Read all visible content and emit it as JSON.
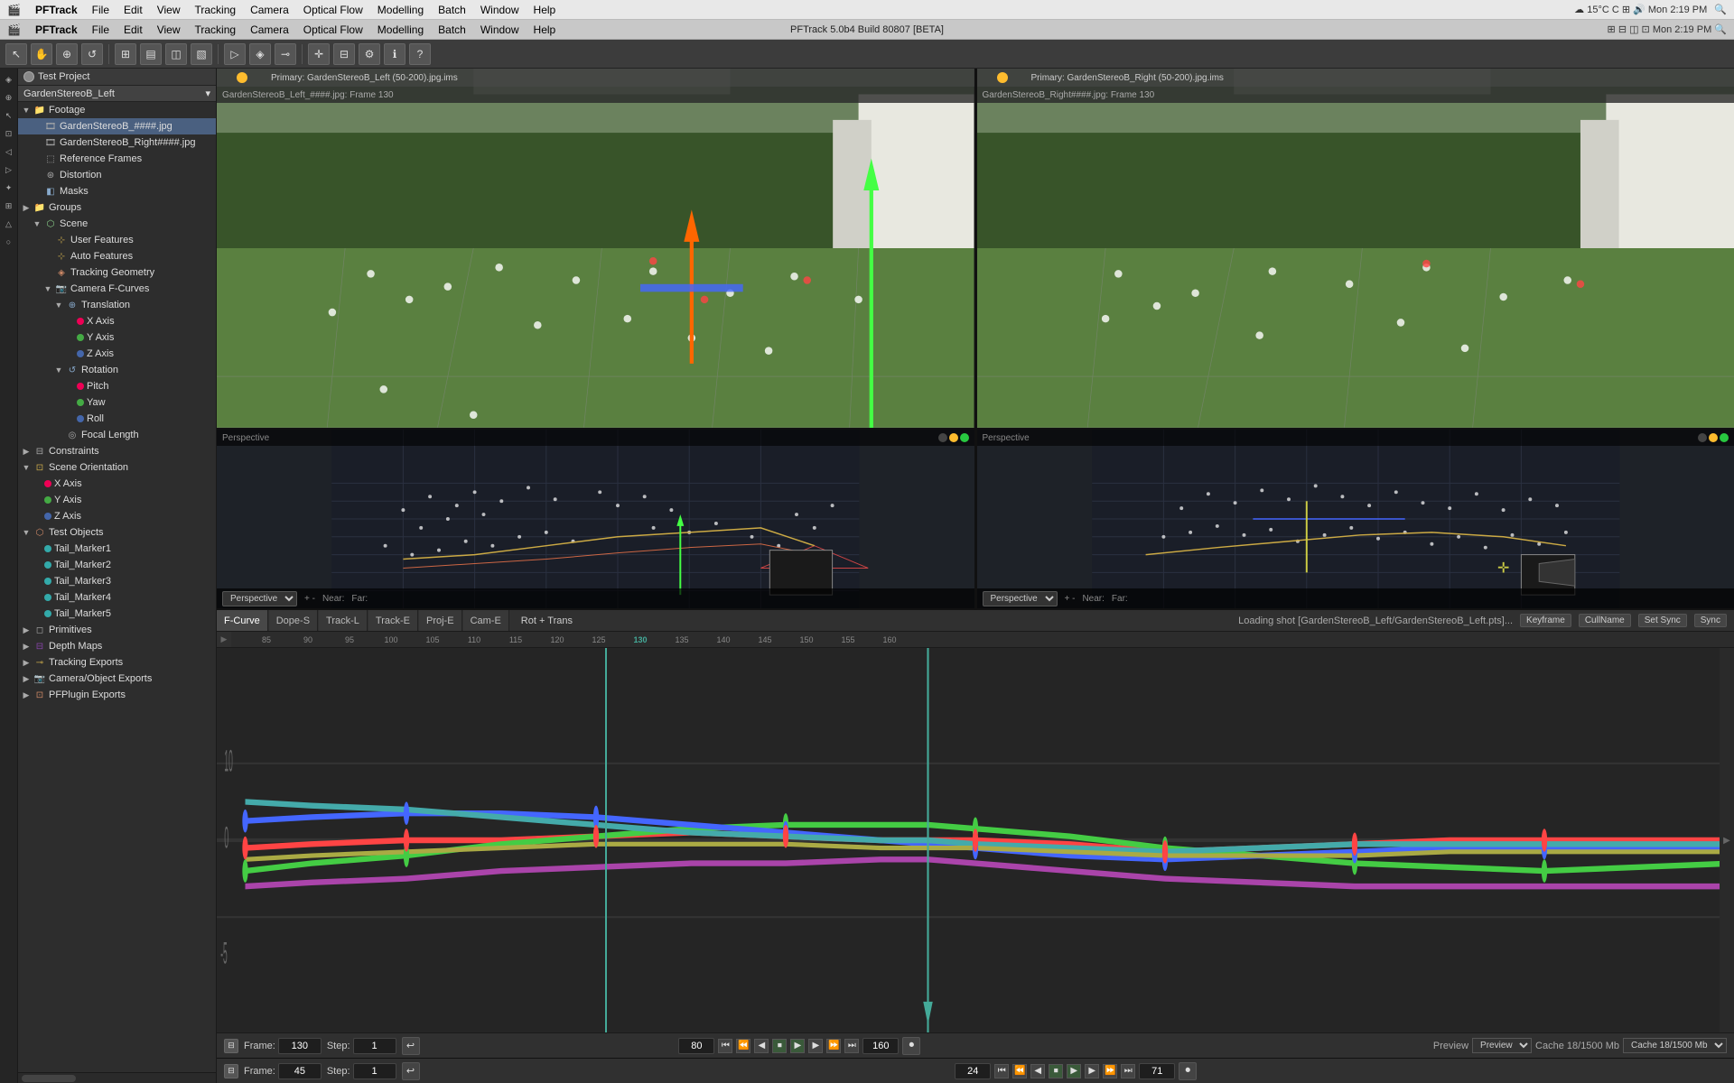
{
  "app": {
    "name": "PFTrack",
    "title": "PFTrack 5.0b4 Build 80807 [BETA]",
    "primary_label": "Primary: GardenStereoB_Left (50-200).jpg.ims",
    "primary_label2": "Primary: GardenStereoB_Right (50-200).jpg.ims"
  },
  "menu": {
    "items": [
      "PFTrack",
      "File",
      "Edit",
      "View",
      "Tracking",
      "Camera",
      "Optical Flow",
      "Modelling",
      "Batch",
      "Window",
      "Help"
    ]
  },
  "toolbar": {
    "buttons": [
      "⊞",
      "▭",
      "▤",
      "⊡",
      "◫",
      "▷",
      "◁",
      "↺",
      "⊕",
      "⊗",
      "⌖",
      "✛",
      "⊸",
      "≡",
      "⊟",
      "⊞",
      "□",
      "◈",
      "▣",
      "⊠"
    ]
  },
  "left_panel": {
    "project_name": "Test Project",
    "camera_name": "GardenStereoB_Left",
    "tree": [
      {
        "id": "footage",
        "label": "Footage",
        "level": 0,
        "icon": "folder",
        "expanded": true
      },
      {
        "id": "gardenL",
        "label": "GardenStereoB_####.jpg",
        "level": 1,
        "icon": "film",
        "selected": true
      },
      {
        "id": "gardenR",
        "label": "GardenStereoB_Right####.jpg",
        "level": 1,
        "icon": "film"
      },
      {
        "id": "refframes",
        "label": "Reference Frames",
        "level": 1,
        "icon": "img"
      },
      {
        "id": "distortion",
        "label": "Distortion",
        "level": 1,
        "icon": "distort"
      },
      {
        "id": "masks",
        "label": "Masks",
        "level": 1,
        "icon": "mask"
      },
      {
        "id": "groups",
        "label": "Groups",
        "level": 0,
        "icon": "folder"
      },
      {
        "id": "scene",
        "label": "Scene",
        "level": 1,
        "icon": "scene",
        "expanded": true
      },
      {
        "id": "userfeatures",
        "label": "User Features",
        "level": 2,
        "icon": "feat"
      },
      {
        "id": "autofeatures",
        "label": "Auto Features",
        "level": 2,
        "icon": "feat"
      },
      {
        "id": "trackgeom",
        "label": "Tracking Geometry",
        "level": 2,
        "icon": "geom"
      },
      {
        "id": "camfcurves",
        "label": "Camera F-Curves",
        "level": 2,
        "icon": "curve",
        "expanded": true
      },
      {
        "id": "translation",
        "label": "Translation",
        "level": 3,
        "icon": "trans",
        "expanded": true
      },
      {
        "id": "xaxis",
        "label": "X Axis",
        "level": 4,
        "icon": "axis",
        "color": "red"
      },
      {
        "id": "yaxis",
        "label": "Y Axis",
        "level": 4,
        "icon": "axis",
        "color": "green"
      },
      {
        "id": "zaxis",
        "label": "Z Axis",
        "level": 4,
        "icon": "axis",
        "color": "blue"
      },
      {
        "id": "rotation",
        "label": "Rotation",
        "level": 3,
        "icon": "rot",
        "expanded": true
      },
      {
        "id": "pitch",
        "label": "Pitch",
        "level": 4,
        "icon": "axis",
        "color": "red"
      },
      {
        "id": "yaw",
        "label": "Yaw",
        "level": 4,
        "icon": "axis",
        "color": "green"
      },
      {
        "id": "roll",
        "label": "Roll",
        "level": 4,
        "icon": "axis",
        "color": "blue"
      },
      {
        "id": "focallength",
        "label": "Focal Length",
        "level": 3,
        "icon": "focal"
      },
      {
        "id": "constraints",
        "label": "Constraints",
        "level": 0,
        "icon": "constraint"
      },
      {
        "id": "sceneorientation",
        "label": "Scene Orientation",
        "level": 0,
        "icon": "orient",
        "expanded": true
      },
      {
        "id": "xaxis2",
        "label": "X Axis",
        "level": 1,
        "icon": "axis",
        "color": "red"
      },
      {
        "id": "yaxis2",
        "label": "Y Axis",
        "level": 1,
        "icon": "axis",
        "color": "green"
      },
      {
        "id": "zaxis2",
        "label": "Z Axis",
        "level": 1,
        "icon": "axis",
        "color": "blue"
      },
      {
        "id": "testobjects",
        "label": "Test Objects",
        "level": 0,
        "icon": "obj",
        "expanded": true
      },
      {
        "id": "tailmarker1",
        "label": "Tail_Marker1",
        "level": 1,
        "icon": "marker"
      },
      {
        "id": "tailmarker2",
        "label": "Tail_Marker2",
        "level": 1,
        "icon": "marker"
      },
      {
        "id": "tailmarker3",
        "label": "Tail_Marker3",
        "level": 1,
        "icon": "marker"
      },
      {
        "id": "tailmarker4",
        "label": "Tail_Marker4",
        "level": 1,
        "icon": "marker"
      },
      {
        "id": "tailmarker5",
        "label": "Tail_Marker5",
        "level": 1,
        "icon": "marker"
      },
      {
        "id": "primitives",
        "label": "Primitives",
        "level": 0,
        "icon": "prim"
      },
      {
        "id": "depthmaps",
        "label": "Depth Maps",
        "level": 0,
        "icon": "depth"
      },
      {
        "id": "trackexports",
        "label": "Tracking Exports",
        "level": 0,
        "icon": "export"
      },
      {
        "id": "cameraexports",
        "label": "Camera/Object Exports",
        "level": 0,
        "icon": "export2"
      },
      {
        "id": "pfpluginexports",
        "label": "PFPlugin Exports",
        "level": 0,
        "icon": "plugin"
      }
    ]
  },
  "viewports": {
    "top_left": {
      "title": "GardenStereoB_Left_####.jpg: Frame 130",
      "label": "Primary: GardenStereoB_Left (50-200).jpg.ims"
    },
    "top_right": {
      "title": "GardenStereoB_Right####.jpg: Frame 130",
      "label": "Primary: GardenStereoB_Right (50-200).jpg.ims"
    },
    "bottom_left": {
      "label": "Perspective"
    },
    "bottom_right": {
      "label": "Perspective"
    }
  },
  "timeline": {
    "tabs": [
      "F-Curve",
      "Dope-S",
      "Track-L",
      "Track-E",
      "Proj-E",
      "Cam-E"
    ],
    "active_tab": "F-Curve",
    "mode": "Rot + Trans",
    "status": "Loading shot [GardenStereoB_Left/GardenStereoB_Left.pts]...",
    "status_btns": [
      "Keyframe",
      "CullName",
      "Set Sync",
      "Sync"
    ],
    "ruler_start": 85,
    "ruler_end": 160,
    "ruler_ticks": [
      85,
      90,
      95,
      100,
      105,
      110,
      115,
      120,
      125,
      130,
      135,
      140,
      145,
      150,
      155,
      160
    ],
    "playhead_frame": 130
  },
  "transport1": {
    "frame_label": "Frame:",
    "frame_value": "130",
    "step_label": "Step:",
    "step_value": "1",
    "in_point": "80",
    "out_point": "160",
    "preview_label": "Preview",
    "cache_label": "Cache 18/1500 Mb"
  },
  "transport2": {
    "frame_label": "Frame:",
    "frame_value": "45",
    "step_label": "Step:",
    "step_value": "1",
    "in_point": "24",
    "out_point": "71"
  },
  "perspective": {
    "near_label": "Near:",
    "far_label": "Far:",
    "label": "Perspective"
  }
}
